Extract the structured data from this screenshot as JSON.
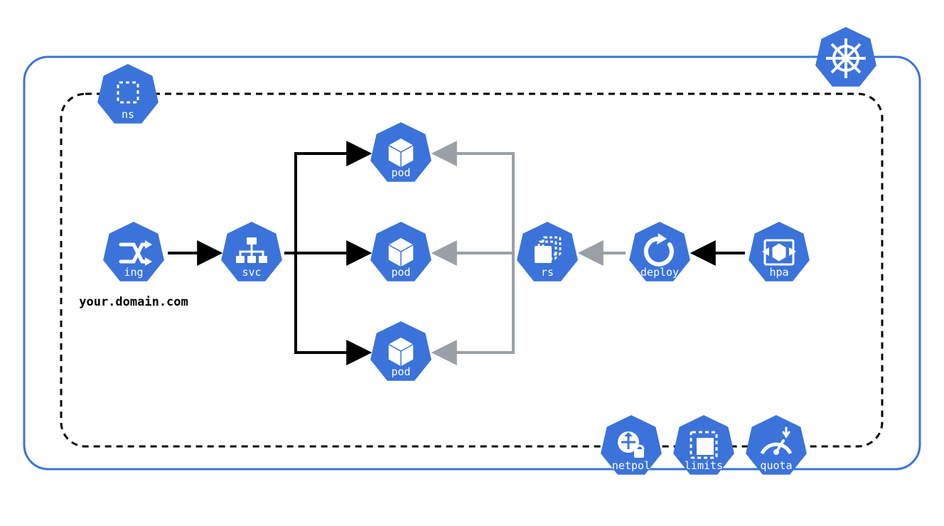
{
  "colors": {
    "blue": "#3b73db",
    "black": "#000000",
    "gray": "#9aa0a6",
    "white": "#ffffff"
  },
  "clusterLogo": {
    "name": "kubernetes-logo-icon"
  },
  "ingressDomain": "your.domain.com",
  "nodes": {
    "ns": {
      "label": "ns",
      "icon": "namespace-icon"
    },
    "ing": {
      "label": "ing",
      "icon": "ingress-icon"
    },
    "svc": {
      "label": "svc",
      "icon": "service-icon"
    },
    "pod1": {
      "label": "pod",
      "icon": "pod-icon"
    },
    "pod2": {
      "label": "pod",
      "icon": "pod-icon"
    },
    "pod3": {
      "label": "pod",
      "icon": "pod-icon"
    },
    "rs": {
      "label": "rs",
      "icon": "replicaset-icon"
    },
    "deploy": {
      "label": "deploy",
      "icon": "deployment-icon"
    },
    "hpa": {
      "label": "hpa",
      "icon": "hpa-icon"
    },
    "netpol": {
      "label": "netpol",
      "icon": "networkpolicy-icon"
    },
    "limits": {
      "label": "limits",
      "icon": "limitrange-icon"
    },
    "quota": {
      "label": "quota",
      "icon": "resourcequota-icon"
    }
  },
  "edges": [
    {
      "from": "ing",
      "to": "svc",
      "color": "black"
    },
    {
      "from": "svc",
      "to": "pod1",
      "color": "black"
    },
    {
      "from": "svc",
      "to": "pod2",
      "color": "black"
    },
    {
      "from": "svc",
      "to": "pod3",
      "color": "black"
    },
    {
      "from": "rs",
      "to": "pod1",
      "color": "gray"
    },
    {
      "from": "rs",
      "to": "pod2",
      "color": "gray"
    },
    {
      "from": "rs",
      "to": "pod3",
      "color": "gray"
    },
    {
      "from": "deploy",
      "to": "rs",
      "color": "gray"
    },
    {
      "from": "hpa",
      "to": "deploy",
      "color": "black"
    }
  ]
}
